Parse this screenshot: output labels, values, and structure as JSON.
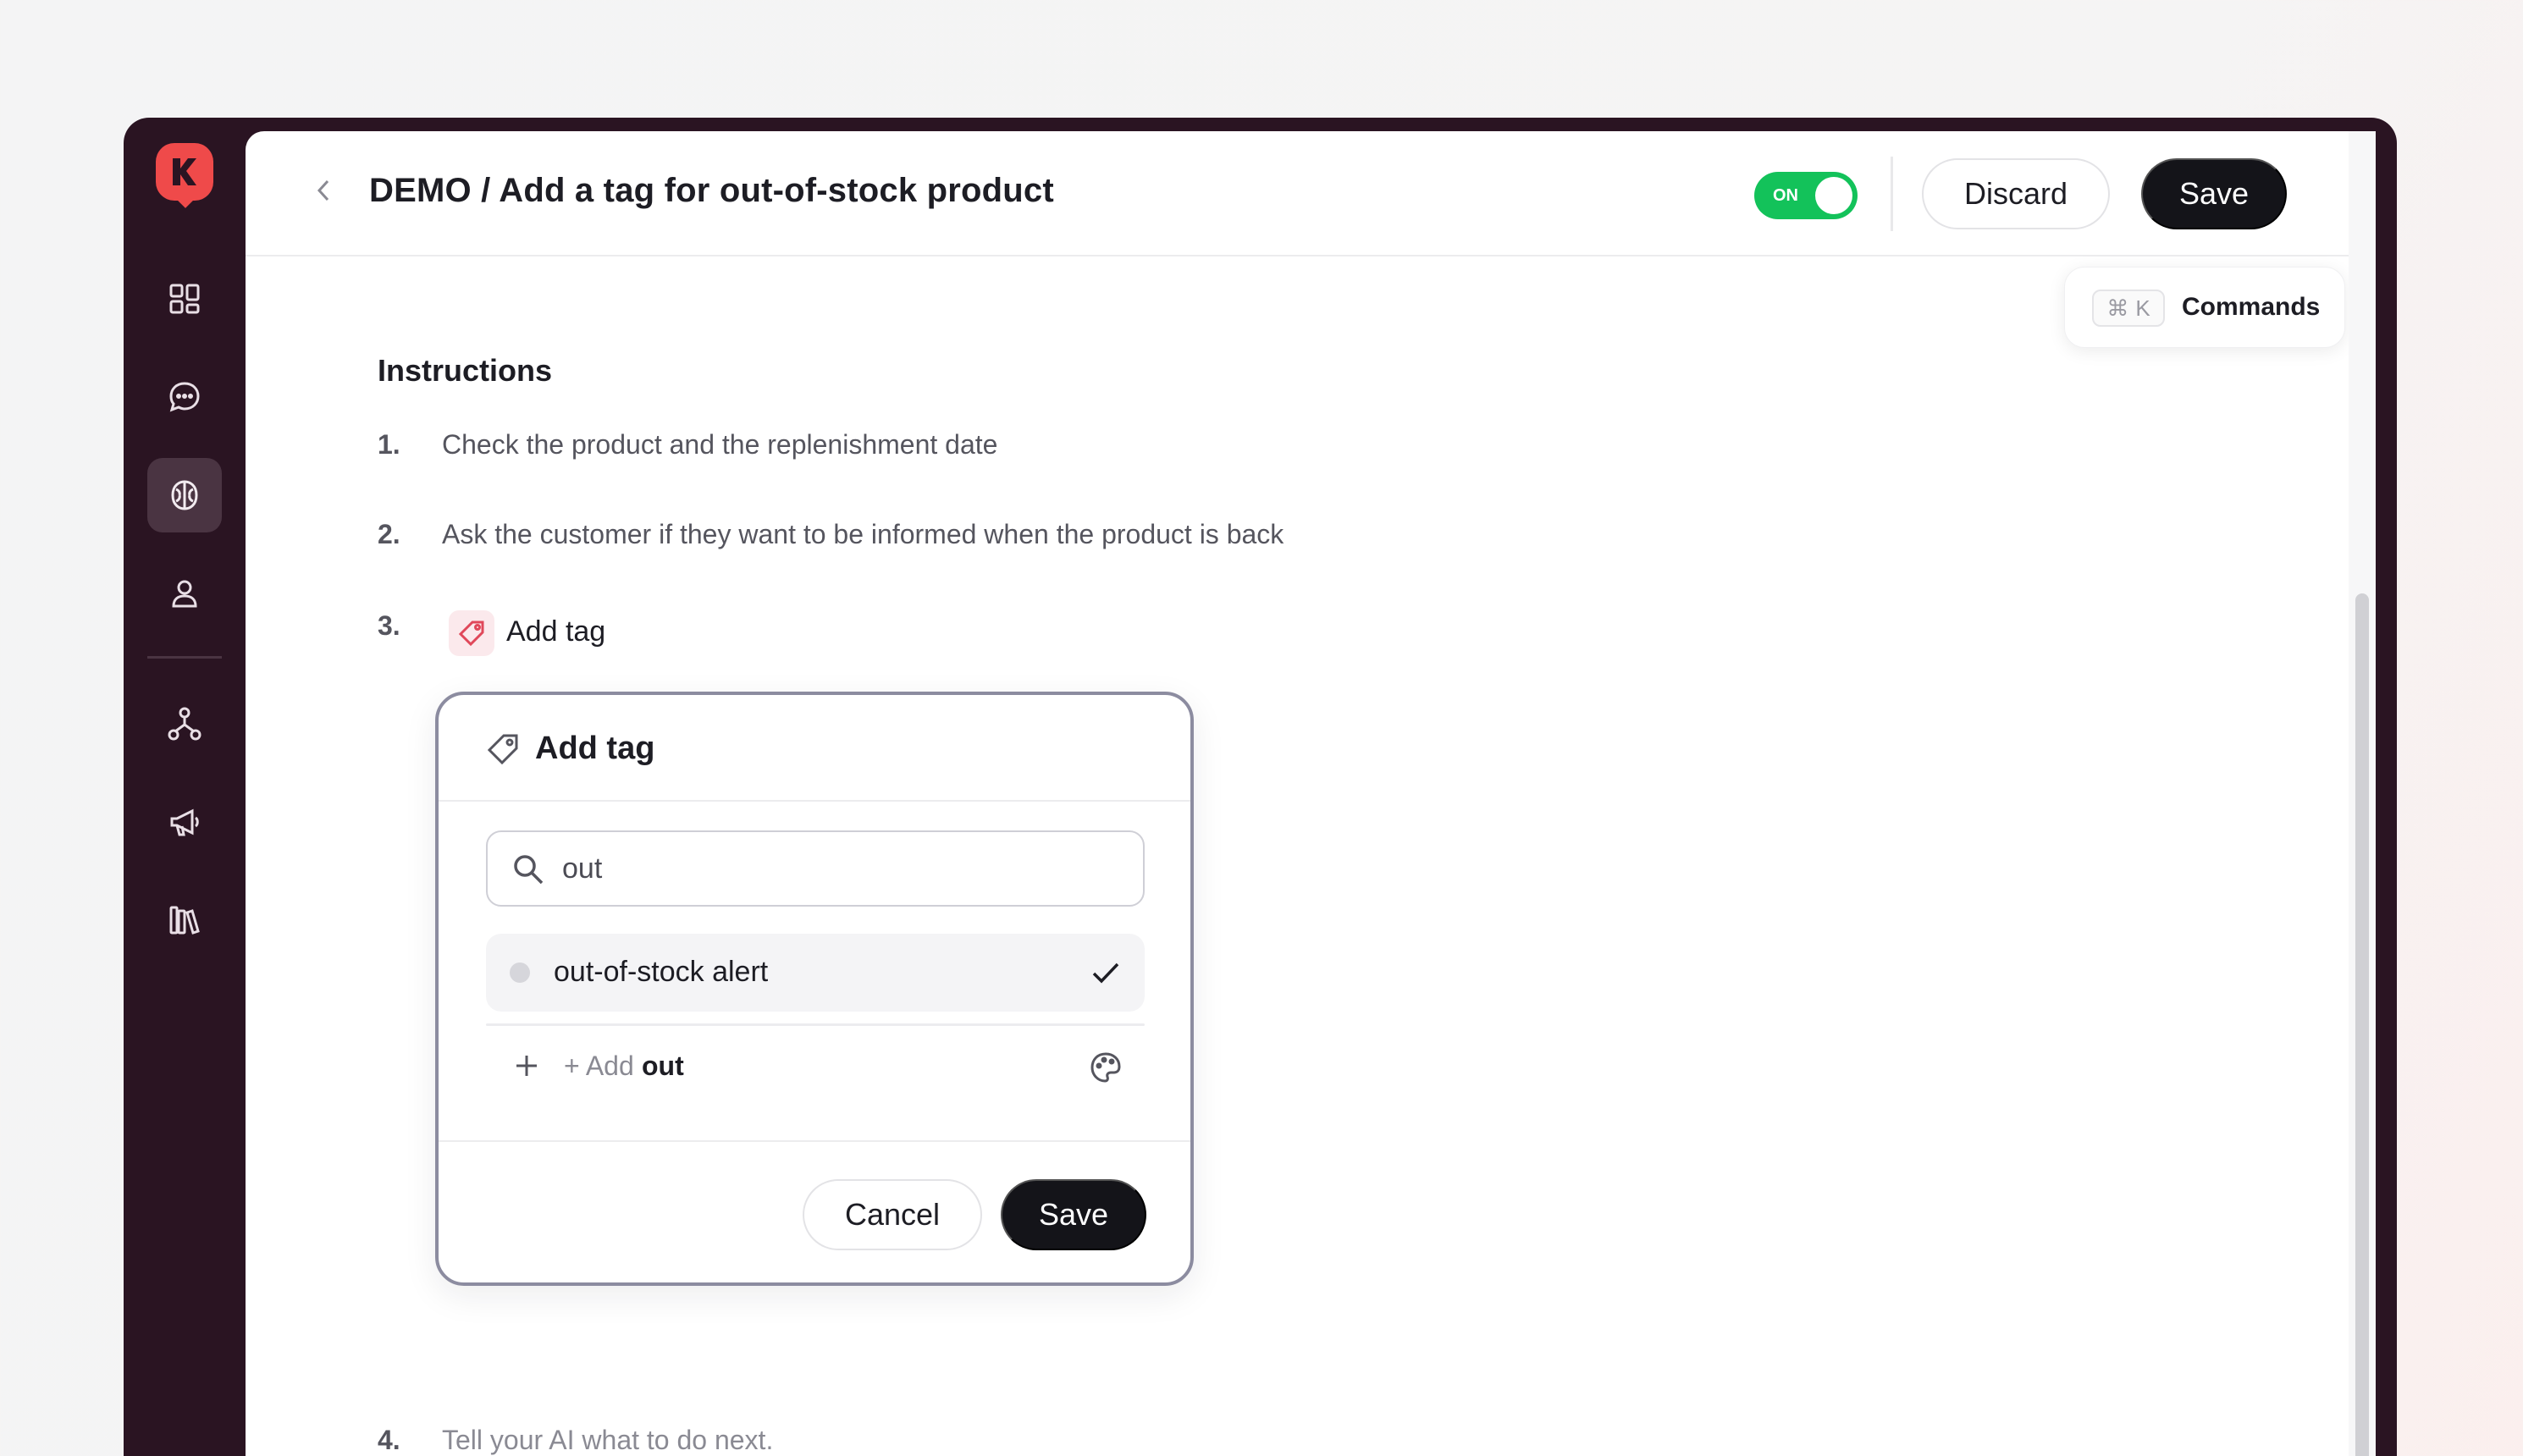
{
  "sidebar": {
    "logo": "k-logo-icon",
    "items": [
      {
        "icon": "dashboard-icon"
      },
      {
        "icon": "chat-icon"
      },
      {
        "icon": "brain-icon",
        "active": true
      },
      {
        "icon": "user-icon"
      },
      {
        "icon": "network-icon"
      },
      {
        "icon": "megaphone-icon"
      },
      {
        "icon": "library-icon"
      }
    ]
  },
  "header": {
    "title": "DEMO / Add a tag for out-of-stock product",
    "toggle_label": "ON",
    "toggle_on": true,
    "discard_label": "Discard",
    "save_label": "Save"
  },
  "commands": {
    "shortcut_key": "K",
    "label": "Commands"
  },
  "instructions": {
    "title": "Instructions",
    "steps": [
      {
        "num": "1.",
        "text": "Check the product and the replenishment date"
      },
      {
        "num": "2.",
        "text": "Ask the customer if they want to be informed when the product is back"
      },
      {
        "num": "3.",
        "text": "Add tag"
      },
      {
        "num": "4.",
        "text": "Tell your AI what to do next."
      }
    ]
  },
  "popup": {
    "title": "Add tag",
    "search_value": "out",
    "options": [
      {
        "label": "out-of-stock alert",
        "selected": true
      }
    ],
    "add_prefix": "+ Add",
    "add_value": "out",
    "cancel_label": "Cancel",
    "save_label": "Save"
  },
  "colors": {
    "sidebar_bg": "#2a1422",
    "brand_red": "#ef4a4a",
    "toggle_green": "#13c25a",
    "dark_button": "#141419"
  }
}
